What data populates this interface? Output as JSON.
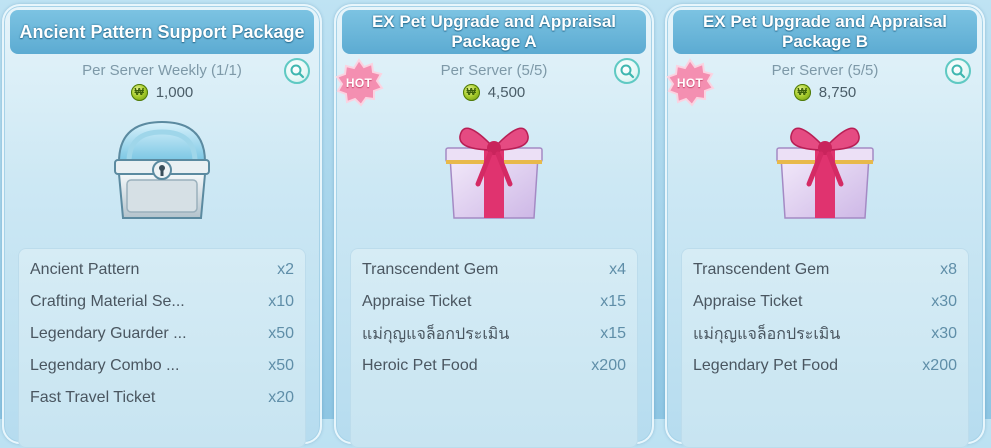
{
  "packages": [
    {
      "title": "Ancient Pattern Support Package",
      "limit": "Per Server Weekly (1/1)",
      "price": "1,000",
      "hot": false,
      "image": "chest-icon",
      "items": [
        {
          "name": "Ancient Pattern",
          "qty": "x2"
        },
        {
          "name": "Crafting Material Se...",
          "qty": "x10"
        },
        {
          "name": "Legendary Guarder ...",
          "qty": "x50"
        },
        {
          "name": "Legendary Combo ...",
          "qty": "x50"
        },
        {
          "name": "Fast Travel Ticket",
          "qty": "x20"
        }
      ]
    },
    {
      "title": "EX Pet Upgrade and Appraisal Package A",
      "limit": "Per Server (5/5)",
      "price": "4,500",
      "hot": true,
      "hot_label": "HOT",
      "image": "gift-box-icon",
      "items": [
        {
          "name": "Transcendent Gem",
          "qty": "x4"
        },
        {
          "name": "Appraise Ticket",
          "qty": "x15"
        },
        {
          "name": "แม่กุญแจล็อกประเมิน",
          "qty": "x15"
        },
        {
          "name": "Heroic Pet Food",
          "qty": "x200"
        }
      ]
    },
    {
      "title": "EX Pet Upgrade and Appraisal Package B",
      "limit": "Per Server (5/5)",
      "price": "8,750",
      "hot": true,
      "hot_label": "HOT",
      "image": "gift-box-icon",
      "items": [
        {
          "name": "Transcendent Gem",
          "qty": "x8"
        },
        {
          "name": "Appraise Ticket",
          "qty": "x30"
        },
        {
          "name": "แม่กุญแจล็อกประเมิน",
          "qty": "x30"
        },
        {
          "name": "Legendary Pet Food",
          "qty": "x200"
        }
      ]
    }
  ],
  "colors": {
    "title_bar": "#5cabd2",
    "hot_badge": "#f48fb1",
    "search_ring": "#5fc9c3",
    "currency": "#a8cc2b"
  }
}
